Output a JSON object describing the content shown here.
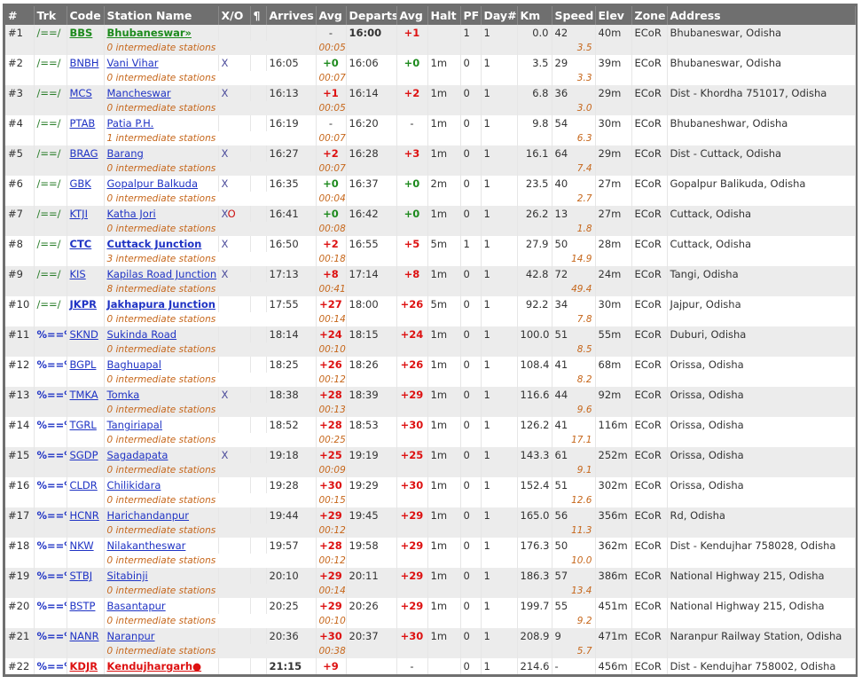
{
  "headers": [
    "#",
    "Trk",
    "Code",
    "Station Name",
    "X/O",
    "¶",
    "Arrives",
    "Avg",
    "Departs",
    "Avg",
    "Halt",
    "PF",
    "Day#",
    "Km",
    "Speed",
    "Elev",
    "Zone",
    "Address"
  ],
  "colors": {
    "header_bg": "#6f6f6f",
    "link": "#1f33c4",
    "late": "#dd1111",
    "ontime": "#1d8a1d",
    "intermediate": "#c6661a"
  },
  "rows": [
    {
      "num": "#1",
      "trk": "/==/",
      "code": "BBS",
      "name": "Bhubaneswar»",
      "style": "green",
      "xo": "",
      "arr": "",
      "arr_avg": "-",
      "arr_cls": "dnone",
      "dep": "16:00",
      "dep_bold": true,
      "dep_avg": "+1",
      "dep_cls": "dlate",
      "halt": "",
      "pf": "1",
      "day": "1",
      "km": "0.0",
      "speed": "42",
      "elev": "40m",
      "zone": "ECoR",
      "addr": "Bhubaneswar, Odisha",
      "inter": "0 intermediate stations",
      "itime": "00:05",
      "ikm": "3.5"
    },
    {
      "num": "#2",
      "trk": "/==/",
      "code": "BNBH",
      "name": "Vani Vihar",
      "style": "",
      "xo": "X",
      "arr": "16:05",
      "arr_avg": "+0",
      "arr_cls": "dontime",
      "dep": "16:06",
      "dep_avg": "+0",
      "dep_cls": "dontime",
      "halt": "1m",
      "pf": "0",
      "day": "1",
      "km": "3.5",
      "speed": "29",
      "elev": "39m",
      "zone": "ECoR",
      "addr": "Bhubaneswar, Odisha",
      "inter": "0 intermediate stations",
      "itime": "00:07",
      "ikm": "3.3"
    },
    {
      "num": "#3",
      "trk": "/==/",
      "code": "MCS",
      "name": "Mancheswar",
      "style": "",
      "xo": "X",
      "arr": "16:13",
      "arr_avg": "+1",
      "arr_cls": "dlate",
      "dep": "16:14",
      "dep_avg": "+2",
      "dep_cls": "dlate",
      "halt": "1m",
      "pf": "0",
      "day": "1",
      "km": "6.8",
      "speed": "36",
      "elev": "29m",
      "zone": "ECoR",
      "addr": "Dist - Khordha 751017, Odisha",
      "inter": "0 intermediate stations",
      "itime": "00:05",
      "ikm": "3.0"
    },
    {
      "num": "#4",
      "trk": "/==/",
      "code": "PTAB",
      "name": "Patia P.H.",
      "style": "",
      "xo": "",
      "arr": "16:19",
      "arr_avg": "-",
      "arr_cls": "dnone",
      "dep": "16:20",
      "dep_avg": "-",
      "dep_cls": "dnone",
      "halt": "1m",
      "pf": "0",
      "day": "1",
      "km": "9.8",
      "speed": "54",
      "elev": "30m",
      "zone": "ECoR",
      "addr": "Bhubaneshwar, Odisha",
      "inter": "1 intermediate stations",
      "itime": "00:07",
      "ikm": "6.3"
    },
    {
      "num": "#5",
      "trk": "/==/",
      "code": "BRAG",
      "name": "Barang",
      "style": "",
      "xo": "X",
      "arr": "16:27",
      "arr_avg": "+2",
      "arr_cls": "dlate",
      "dep": "16:28",
      "dep_avg": "+3",
      "dep_cls": "dlate",
      "halt": "1m",
      "pf": "0",
      "day": "1",
      "km": "16.1",
      "speed": "64",
      "elev": "29m",
      "zone": "ECoR",
      "addr": "Dist - Cuttack, Odisha",
      "inter": "0 intermediate stations",
      "itime": "00:07",
      "ikm": "7.4"
    },
    {
      "num": "#6",
      "trk": "/==/",
      "code": "GBK",
      "name": "Gopalpur Balkuda",
      "style": "",
      "xo": "X",
      "arr": "16:35",
      "arr_avg": "+0",
      "arr_cls": "dontime",
      "dep": "16:37",
      "dep_avg": "+0",
      "dep_cls": "dontime",
      "halt": "2m",
      "pf": "0",
      "day": "1",
      "km": "23.5",
      "speed": "40",
      "elev": "27m",
      "zone": "ECoR",
      "addr": "Gopalpur Balikuda, Odisha",
      "inter": "0 intermediate stations",
      "itime": "00:04",
      "ikm": "2.7"
    },
    {
      "num": "#7",
      "trk": "/==/",
      "code": "KTJI",
      "name": "Katha Jori",
      "style": "",
      "xo": "XO",
      "arr": "16:41",
      "arr_avg": "+0",
      "arr_cls": "dontime",
      "dep": "16:42",
      "dep_avg": "+0",
      "dep_cls": "dontime",
      "halt": "1m",
      "pf": "0",
      "day": "1",
      "km": "26.2",
      "speed": "13",
      "elev": "27m",
      "zone": "ECoR",
      "addr": "Cuttack, Odisha",
      "inter": "0 intermediate stations",
      "itime": "00:08",
      "ikm": "1.8"
    },
    {
      "num": "#8",
      "trk": "/==/",
      "code": "CTC",
      "name": "Cuttack Junction",
      "style": "bold",
      "xo": "X",
      "arr": "16:50",
      "arr_avg": "+2",
      "arr_cls": "dlate",
      "dep": "16:55",
      "dep_avg": "+5",
      "dep_cls": "dlate",
      "halt": "5m",
      "pf": "1",
      "day": "1",
      "km": "27.9",
      "speed": "50",
      "elev": "28m",
      "zone": "ECoR",
      "addr": "Cuttack, Odisha",
      "inter": "3 intermediate stations",
      "itime": "00:18",
      "ikm": "14.9"
    },
    {
      "num": "#9",
      "trk": "/==/",
      "code": "KIS",
      "name": "Kapilas Road Junction",
      "style": "",
      "xo": "X",
      "arr": "17:13",
      "arr_avg": "+8",
      "arr_cls": "dlate",
      "dep": "17:14",
      "dep_avg": "+8",
      "dep_cls": "dlate",
      "halt": "1m",
      "pf": "0",
      "day": "1",
      "km": "42.8",
      "speed": "72",
      "elev": "24m",
      "zone": "ECoR",
      "addr": "Tangi, Odisha",
      "inter": "8 intermediate stations",
      "itime": "00:41",
      "ikm": "49.4"
    },
    {
      "num": "#10",
      "trk": "/==/",
      "code": "JKPR",
      "name": "Jakhapura Junction",
      "style": "bold",
      "xo": "",
      "arr": "17:55",
      "arr_avg": "+27",
      "arr_cls": "dlate",
      "dep": "18:00",
      "dep_avg": "+26",
      "dep_cls": "dlate",
      "halt": "5m",
      "pf": "0",
      "day": "1",
      "km": "92.2",
      "speed": "34",
      "elev": "30m",
      "zone": "ECoR",
      "addr": "Jajpur, Odisha",
      "inter": "0 intermediate stations",
      "itime": "00:14",
      "ikm": "7.8"
    },
    {
      "num": "#11",
      "trk": "%==%",
      "code": "SKND",
      "name": "Sukinda Road",
      "style": "",
      "xo": "",
      "arr": "18:14",
      "arr_avg": "+24",
      "arr_cls": "dlate",
      "dep": "18:15",
      "dep_avg": "+24",
      "dep_cls": "dlate",
      "halt": "1m",
      "pf": "0",
      "day": "1",
      "km": "100.0",
      "speed": "51",
      "elev": "55m",
      "zone": "ECoR",
      "addr": "Duburi, Odisha",
      "inter": "0 intermediate stations",
      "itime": "00:10",
      "ikm": "8.5"
    },
    {
      "num": "#12",
      "trk": "%==%",
      "code": "BGPL",
      "name": "Baghuapal",
      "style": "",
      "xo": "",
      "arr": "18:25",
      "arr_avg": "+26",
      "arr_cls": "dlate",
      "dep": "18:26",
      "dep_avg": "+26",
      "dep_cls": "dlate",
      "halt": "1m",
      "pf": "0",
      "day": "1",
      "km": "108.4",
      "speed": "41",
      "elev": "68m",
      "zone": "ECoR",
      "addr": "Orissa, Odisha",
      "inter": "0 intermediate stations",
      "itime": "00:12",
      "ikm": "8.2"
    },
    {
      "num": "#13",
      "trk": "%==%",
      "code": "TMKA",
      "name": "Tomka",
      "style": "",
      "xo": "X",
      "arr": "18:38",
      "arr_avg": "+28",
      "arr_cls": "dlate",
      "dep": "18:39",
      "dep_avg": "+29",
      "dep_cls": "dlate",
      "halt": "1m",
      "pf": "0",
      "day": "1",
      "km": "116.6",
      "speed": "44",
      "elev": "92m",
      "zone": "ECoR",
      "addr": "Orissa, Odisha",
      "inter": "0 intermediate stations",
      "itime": "00:13",
      "ikm": "9.6"
    },
    {
      "num": "#14",
      "trk": "%==%",
      "code": "TGRL",
      "name": "Tangiriapal",
      "style": "",
      "xo": "",
      "arr": "18:52",
      "arr_avg": "+28",
      "arr_cls": "dlate",
      "dep": "18:53",
      "dep_avg": "+30",
      "dep_cls": "dlate",
      "halt": "1m",
      "pf": "0",
      "day": "1",
      "km": "126.2",
      "speed": "41",
      "elev": "116m",
      "zone": "ECoR",
      "addr": "Orissa, Odisha",
      "inter": "0 intermediate stations",
      "itime": "00:25",
      "ikm": "17.1"
    },
    {
      "num": "#15",
      "trk": "%==%",
      "code": "SGDP",
      "name": "Sagadapata",
      "style": "",
      "xo": "X",
      "arr": "19:18",
      "arr_avg": "+25",
      "arr_cls": "dlate",
      "dep": "19:19",
      "dep_avg": "+25",
      "dep_cls": "dlate",
      "halt": "1m",
      "pf": "0",
      "day": "1",
      "km": "143.3",
      "speed": "61",
      "elev": "252m",
      "zone": "ECoR",
      "addr": "Orissa, Odisha",
      "inter": "0 intermediate stations",
      "itime": "00:09",
      "ikm": "9.1"
    },
    {
      "num": "#16",
      "trk": "%==%",
      "code": "CLDR",
      "name": "Chilikidara",
      "style": "",
      "xo": "",
      "arr": "19:28",
      "arr_avg": "+30",
      "arr_cls": "dlate",
      "dep": "19:29",
      "dep_avg": "+30",
      "dep_cls": "dlate",
      "halt": "1m",
      "pf": "0",
      "day": "1",
      "km": "152.4",
      "speed": "51",
      "elev": "302m",
      "zone": "ECoR",
      "addr": "Orissa, Odisha",
      "inter": "0 intermediate stations",
      "itime": "00:15",
      "ikm": "12.6"
    },
    {
      "num": "#17",
      "trk": "%==%",
      "code": "HCNR",
      "name": "Harichandanpur",
      "style": "",
      "xo": "",
      "arr": "19:44",
      "arr_avg": "+29",
      "arr_cls": "dlate",
      "dep": "19:45",
      "dep_avg": "+29",
      "dep_cls": "dlate",
      "halt": "1m",
      "pf": "0",
      "day": "1",
      "km": "165.0",
      "speed": "56",
      "elev": "356m",
      "zone": "ECoR",
      "addr": "Rd, Odisha",
      "inter": "0 intermediate stations",
      "itime": "00:12",
      "ikm": "11.3"
    },
    {
      "num": "#18",
      "trk": "%==%",
      "code": "NKW",
      "name": "Nilakantheswar",
      "style": "",
      "xo": "",
      "arr": "19:57",
      "arr_avg": "+28",
      "arr_cls": "dlate",
      "dep": "19:58",
      "dep_avg": "+29",
      "dep_cls": "dlate",
      "halt": "1m",
      "pf": "0",
      "day": "1",
      "km": "176.3",
      "speed": "50",
      "elev": "362m",
      "zone": "ECoR",
      "addr": "Dist - Kendujhar 758028, Odisha",
      "inter": "0 intermediate stations",
      "itime": "00:12",
      "ikm": "10.0"
    },
    {
      "num": "#19",
      "trk": "%==%",
      "code": "STBJ",
      "name": "Sitabinji",
      "style": "",
      "xo": "",
      "arr": "20:10",
      "arr_avg": "+29",
      "arr_cls": "dlate",
      "dep": "20:11",
      "dep_avg": "+29",
      "dep_cls": "dlate",
      "halt": "1m",
      "pf": "0",
      "day": "1",
      "km": "186.3",
      "speed": "57",
      "elev": "386m",
      "zone": "ECoR",
      "addr": "National Highway 215, Odisha",
      "inter": "0 intermediate stations",
      "itime": "00:14",
      "ikm": "13.4"
    },
    {
      "num": "#20",
      "trk": "%==%",
      "code": "BSTP",
      "name": "Basantapur",
      "style": "",
      "xo": "",
      "arr": "20:25",
      "arr_avg": "+29",
      "arr_cls": "dlate",
      "dep": "20:26",
      "dep_avg": "+29",
      "dep_cls": "dlate",
      "halt": "1m",
      "pf": "0",
      "day": "1",
      "km": "199.7",
      "speed": "55",
      "elev": "451m",
      "zone": "ECoR",
      "addr": "National Highway 215, Odisha",
      "inter": "0 intermediate stations",
      "itime": "00:10",
      "ikm": "9.2"
    },
    {
      "num": "#21",
      "trk": "%==%",
      "code": "NANR",
      "name": "Naranpur",
      "style": "",
      "xo": "",
      "arr": "20:36",
      "arr_avg": "+30",
      "arr_cls": "dlate",
      "dep": "20:37",
      "dep_avg": "+30",
      "dep_cls": "dlate",
      "halt": "1m",
      "pf": "0",
      "day": "1",
      "km": "208.9",
      "speed": "9",
      "elev": "471m",
      "zone": "ECoR",
      "addr": "Naranpur Railway Station, Odisha",
      "inter": "0 intermediate stations",
      "itime": "00:38",
      "ikm": "5.7"
    },
    {
      "num": "#22",
      "trk": "%==%",
      "code": "KDJR",
      "name": "Kendujhargarh●",
      "style": "red",
      "xo": "",
      "arr": "21:15",
      "arr_bold": true,
      "arr_avg": "+9",
      "arr_cls": "dlate",
      "dep": "",
      "dep_avg": "-",
      "dep_cls": "dnone",
      "halt": "",
      "pf": "0",
      "day": "1",
      "km": "214.6",
      "speed": "-",
      "elev": "456m",
      "zone": "ECoR",
      "addr": "Dist - Kendujhar 758002, Odisha"
    }
  ]
}
